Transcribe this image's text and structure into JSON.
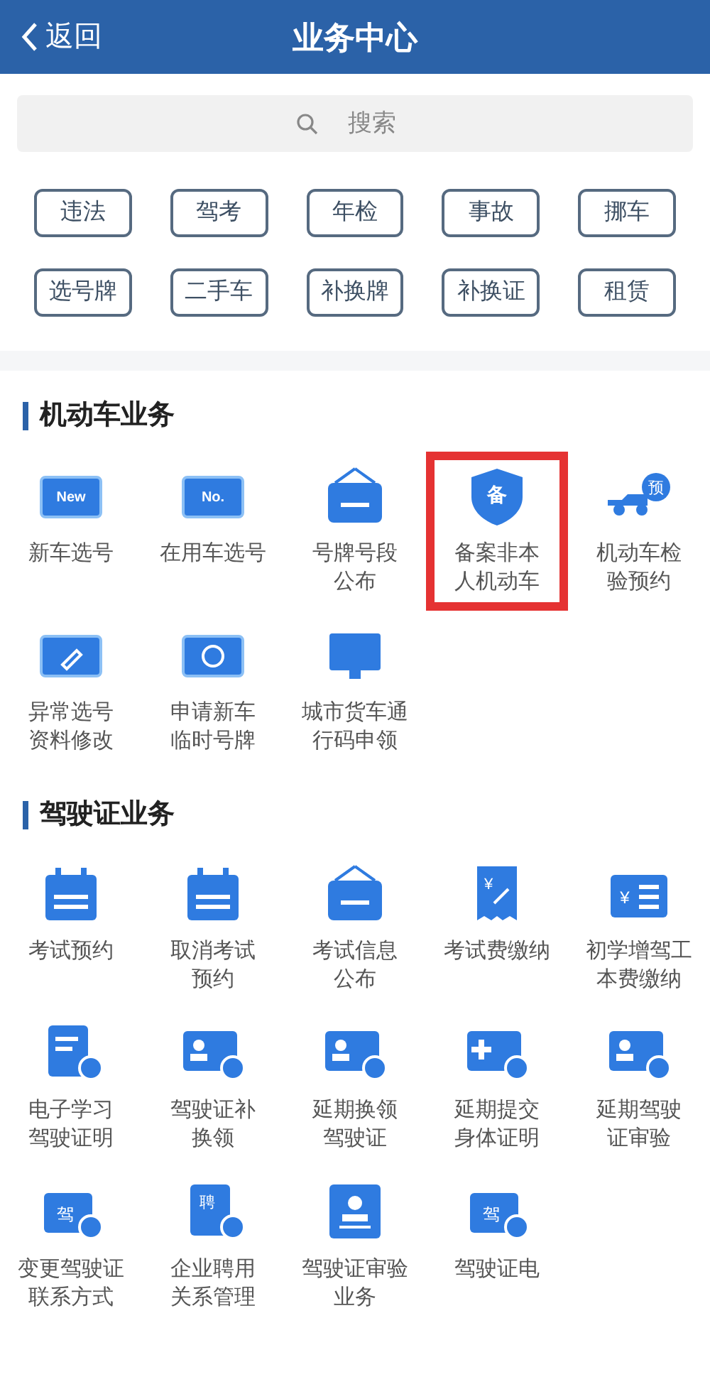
{
  "header": {
    "back": "返回",
    "title": "业务中心"
  },
  "search": {
    "placeholder": "搜索"
  },
  "quick_tags": [
    "违法",
    "驾考",
    "年检",
    "事故",
    "挪车",
    "选号牌",
    "二手车",
    "补换牌",
    "补换证",
    "租赁"
  ],
  "sections": [
    {
      "title": "机动车业务",
      "items": [
        {
          "kind": "plate",
          "glyph": "New",
          "lines": [
            "新车选号"
          ],
          "highlighted": false
        },
        {
          "kind": "plate",
          "glyph": "No.",
          "lines": [
            "在用车选号"
          ],
          "highlighted": false
        },
        {
          "kind": "sign",
          "lines": [
            "号牌号段",
            "公布"
          ],
          "highlighted": false
        },
        {
          "kind": "shield",
          "glyph": "备",
          "lines": [
            "备案非本",
            "人机动车"
          ],
          "highlighted": true
        },
        {
          "kind": "truck",
          "glyph": "预",
          "lines": [
            "机动车检",
            "验预约"
          ],
          "highlighted": false
        },
        {
          "kind": "plate-pen",
          "lines": [
            "异常选号",
            "资料修改"
          ],
          "highlighted": false
        },
        {
          "kind": "plate-clock",
          "lines": [
            "申请新车",
            "临时号牌"
          ],
          "highlighted": false
        },
        {
          "kind": "screen",
          "lines": [
            "城市货车通",
            "行码申领"
          ],
          "highlighted": false
        }
      ]
    },
    {
      "title": "驾驶证业务",
      "items": [
        {
          "kind": "calendar",
          "lines": [
            "考试预约"
          ],
          "highlighted": false
        },
        {
          "kind": "calendar",
          "lines": [
            "取消考试",
            "预约"
          ],
          "highlighted": false
        },
        {
          "kind": "sign",
          "lines": [
            "考试信息",
            "公布"
          ],
          "highlighted": false
        },
        {
          "kind": "receipt",
          "glyph": "¥",
          "lines": [
            "考试费缴纳"
          ],
          "highlighted": false
        },
        {
          "kind": "list",
          "glyph": "¥",
          "lines": [
            "初学增驾工",
            "本费缴纳"
          ],
          "highlighted": false
        },
        {
          "kind": "doc-badge",
          "lines": [
            "电子学习",
            "驾驶证明"
          ],
          "highlighted": false
        },
        {
          "kind": "user-badge",
          "lines": [
            "驾驶证补",
            "换领"
          ],
          "highlighted": false
        },
        {
          "kind": "user-badge",
          "lines": [
            "延期换领",
            "驾驶证"
          ],
          "highlighted": false
        },
        {
          "kind": "plus-badge",
          "lines": [
            "延期提交",
            "身体证明"
          ],
          "highlighted": false
        },
        {
          "kind": "user-badge",
          "lines": [
            "延期驾驶",
            "证审验"
          ],
          "highlighted": false
        },
        {
          "kind": "card-badge",
          "glyph": "驾",
          "lines": [
            "变更驾驶证",
            "联系方式"
          ],
          "highlighted": false
        },
        {
          "kind": "doc-badge",
          "glyph": "聘",
          "lines": [
            "企业聘用",
            "关系管理"
          ],
          "highlighted": false
        },
        {
          "kind": "stamp",
          "lines": [
            "驾驶证审验",
            "业务"
          ],
          "highlighted": false
        },
        {
          "kind": "card-badge",
          "glyph": "驾",
          "lines": [
            "驾驶证电"
          ],
          "highlighted": false
        }
      ]
    }
  ]
}
